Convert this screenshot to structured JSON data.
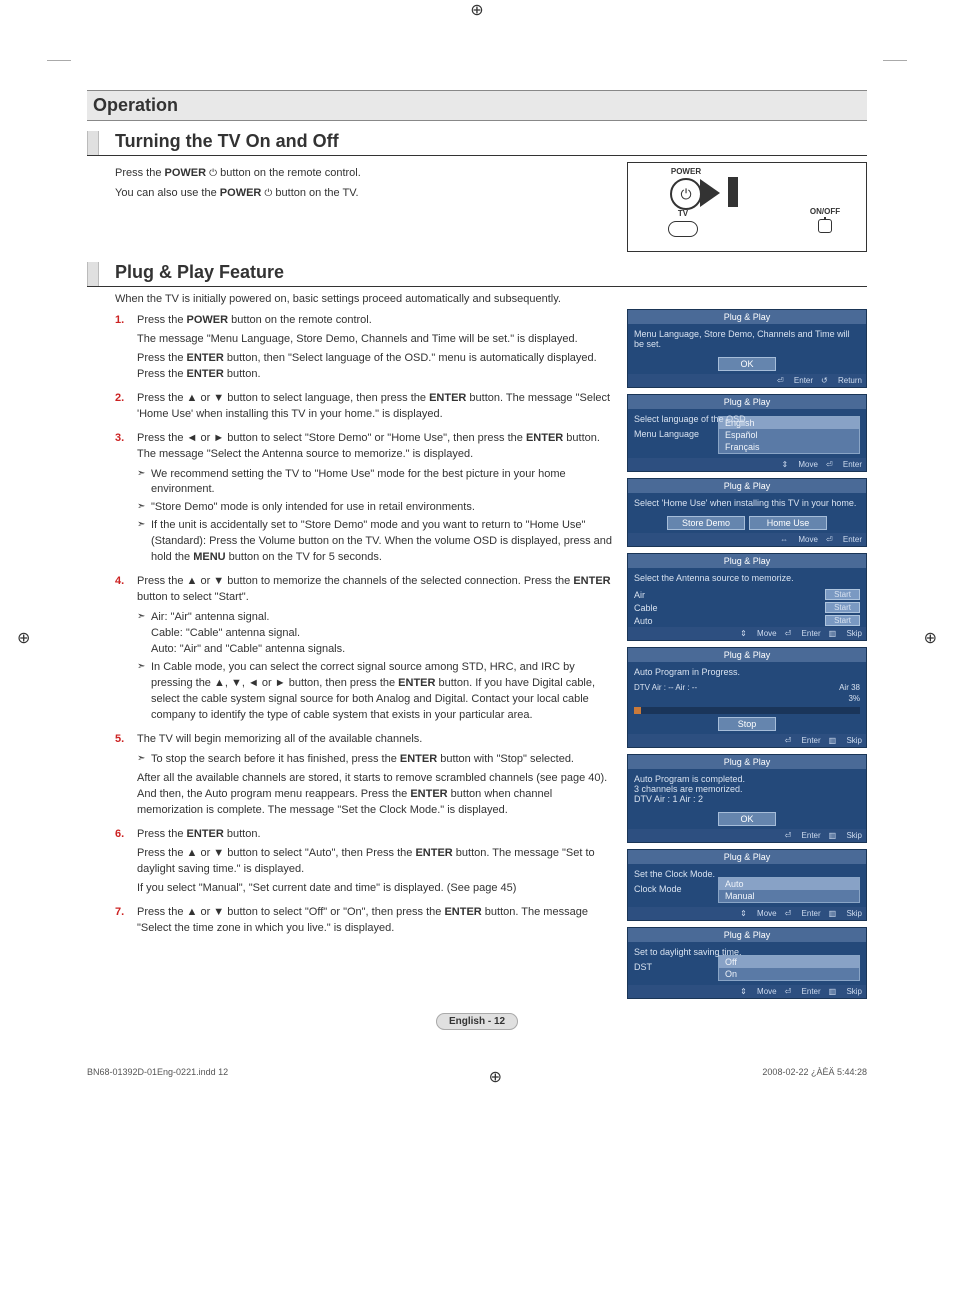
{
  "meta": {
    "indd": "BN68-01392D-01Eng-0221.indd   12",
    "stamp": "2008-02-22   ¿ÀÈÄ 5:44:28"
  },
  "section_title": "Operation",
  "h2_a": "Turning the TV On and Off",
  "intro_a1": "Press the POWER button on the remote control.",
  "intro_a2": "You can also use the POWER button on the TV.",
  "remote": {
    "power": "POWER",
    "tv": "TV",
    "onoff": "ON/OFF"
  },
  "h2_b": "Plug & Play Feature",
  "intro_b": "When the TV is initially powered on, basic settings proceed automatically and subsequently.",
  "steps": [
    {
      "n": "1.",
      "lines": [
        "Press the <b>POWER</b> button on the remote control.",
        "The message \"Menu Language, Store Demo, Channels and Time will be set.\" is displayed.",
        "Press the <b>ENTER</b> button, then \"Select language of the OSD.\" menu is automatically displayed. Press the <b>ENTER</b> button."
      ]
    },
    {
      "n": "2.",
      "lines": [
        "Press the ▲ or ▼ button to select language, then press the <b>ENTER</b> button. The message \"Select 'Home Use' when installing this TV in your home.\" is displayed."
      ]
    },
    {
      "n": "3.",
      "lines": [
        "Press the ◄ or ► button to select \"Store Demo\" or \"Home Use\", then press the <b>ENTER</b> button. The message \"Select the Antenna source to memorize.\" is displayed."
      ],
      "arrows": [
        "We recommend setting the TV to \"Home Use\" mode for the best picture in your home environment.",
        "\"Store Demo\" mode is only intended for use in retail environments.",
        "If the unit is accidentally set to \"Store Demo\" mode and you want to return to \"Home Use\" (Standard): Press the Volume button on the TV. When the volume OSD is displayed, press and hold the <b>MENU</b> button on the TV for 5 seconds."
      ]
    },
    {
      "n": "4.",
      "lines": [
        "Press the ▲ or ▼ button to memorize the channels of the selected connection. Press the <b>ENTER</b> button to select \"Start\"."
      ],
      "arrows": [
        "Air: \"Air\" antenna signal.<br>Cable: \"Cable\" antenna signal.<br>Auto: \"Air\" and \"Cable\" antenna signals.",
        "In Cable mode, you can select the correct signal source among STD, HRC, and IRC by pressing the ▲, ▼, ◄ or ► button, then press the <b>ENTER</b> button. If you have Digital cable, select the cable system signal source for both Analog and Digital. Contact your local cable company to identify the type of cable system that exists in your particular area."
      ]
    },
    {
      "n": "5.",
      "lines": [
        "The TV will begin memorizing all of the available channels."
      ],
      "arrows": [
        "To stop the search before it has finished, press the <b>ENTER</b> button with \"Stop\" selected."
      ],
      "after": "After all the available channels are stored, it starts to remove scrambled channels (see page 40). And then, the Auto program menu reappears. Press the <b>ENTER</b> button when channel memorization is complete. The message \"Set the Clock Mode.\" is displayed."
    },
    {
      "n": "6.",
      "lines": [
        "Press the <b>ENTER</b> button.",
        "Press the ▲ or ▼ button to select \"Auto\", then Press the <b>ENTER</b> button. The message \"Set to daylight saving time.\" is displayed.",
        "If you select \"Manual\", \"Set current date and time\" is displayed. (See page 45)"
      ]
    },
    {
      "n": "7.",
      "lines": [
        "Press the ▲ or ▼ button to select \"Off\" or \"On\", then press the <b>ENTER</b> button. The message \"Select the time zone in which you live.\" is displayed."
      ]
    }
  ],
  "osd": {
    "pp": "Plug & Play",
    "s1_msg": "Menu Language, Store Demo, Channels and Time will be set.",
    "ok": "OK",
    "enter": "Enter",
    "return": "Return",
    "move_ud": "Move",
    "move_lr": "Move",
    "skip": "Skip",
    "s2_msg": "Select language of the OSD.",
    "s2_label": "Menu Language",
    "langs": [
      "English",
      "Español",
      "Français"
    ],
    "s3_msg": "Select 'Home Use' when installing this TV in your home.",
    "store_demo": "Store Demo",
    "home_use": "Home Use",
    "s4_msg": "Select the Antenna source to memorize.",
    "air": "Air",
    "cable": "Cable",
    "auto": "Auto",
    "start": "Start",
    "s5_msg": "Auto Program in Progress.",
    "s5_line": "DTV Air : --      Air : --",
    "s5_right": "Air 38",
    "s5_pct": "3%",
    "stop": "Stop",
    "s6_l1": "Auto Program is completed.",
    "s6_l2": "3 channels are memorized.",
    "s6_l3": "DTV Air : 1    Air : 2",
    "s7_msg": "Set the Clock Mode.",
    "s7_label": "Clock Mode",
    "s7_opts": [
      "Auto",
      "Manual"
    ],
    "s8_msg": "Set to daylight saving time.",
    "s8_label": "DST",
    "s8_opts": [
      "Off",
      "On"
    ]
  },
  "footer": "English - 12"
}
